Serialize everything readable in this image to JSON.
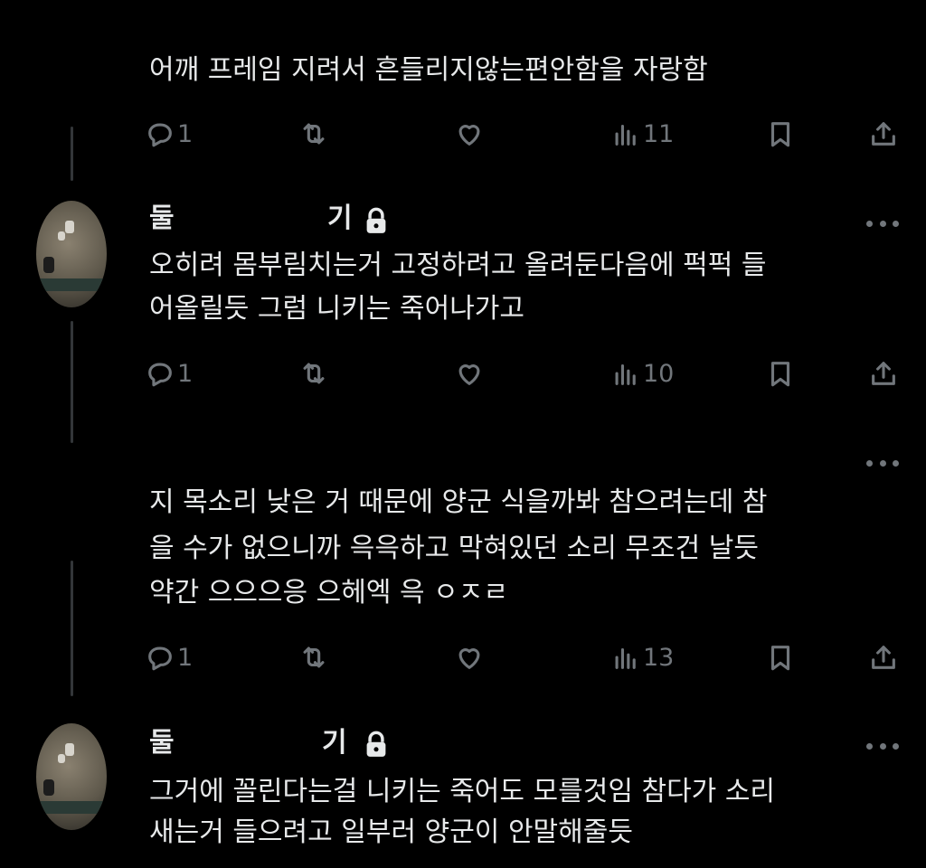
{
  "posts": [
    {
      "text_lines": [
        "어깨 프레임 지려서 흔들리지않는편안함을 자랑함"
      ],
      "replies": "1",
      "views": "11"
    },
    {
      "author": "둘",
      "author_suffix": "기",
      "text_lines": [
        "오히려 몸부림치는거 고정하려고 올려둔다음에 퍽퍽 들",
        "어올릴듯 그럼 니키는 죽어나가고"
      ],
      "replies": "1",
      "views": "10"
    },
    {
      "text_lines": [
        "지 목소리 낮은 거 때문에 양군 식을까봐 참으려는데 참",
        "을 수가 없으니까 윽윽하고 막혀있던 소리 무조건 날듯",
        "약간 으으으응 으헤엑 윽 ㅇㅈㄹ"
      ],
      "replies": "1",
      "views": "13"
    },
    {
      "author": "둘",
      "author_suffix": "기",
      "text_lines": [
        "그거에 꼴린다는걸 니키는 죽어도 모를것임 참다가 소리",
        "새는거 들으려고 일부러 양군이 안말해줄듯"
      ]
    }
  ],
  "icons": {
    "reply": "reply-icon",
    "repost": "repost-icon",
    "like": "like-icon",
    "views": "views-icon",
    "bookmark": "bookmark-icon",
    "share": "share-icon",
    "more": "more-icon",
    "lock": "lock-icon"
  },
  "colors": {
    "background": "#000000",
    "text": "#e7e9ea",
    "muted": "#71767b"
  }
}
